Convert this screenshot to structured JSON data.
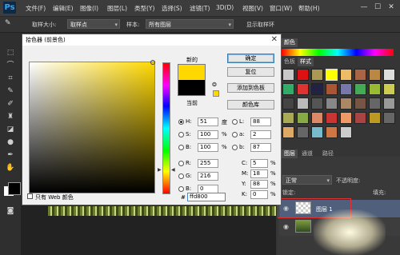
{
  "app": {
    "logo": "Ps"
  },
  "menu": [
    "文件(F)",
    "编辑(E)",
    "图像(I)",
    "图层(L)",
    "类型(Y)",
    "选择(S)",
    "滤镜(T)",
    "3D(D)",
    "视图(V)",
    "窗口(W)",
    "帮助(H)"
  ],
  "window_controls": {
    "minimize": "—",
    "maximize": "☐",
    "close": "✕"
  },
  "options_bar": {
    "sample_size_label": "取样大小:",
    "sample_size_value": "取样点",
    "sample_label": "样本:",
    "sample_value": "所有图层",
    "show_ring_label": "显示取样环"
  },
  "dialog": {
    "title": "拾色器 (前景色)",
    "close": "✕",
    "new_label": "新的",
    "current_label": "当前",
    "buttons": {
      "ok": "确定",
      "reset": "复位",
      "add_swatch": "添加到色板",
      "color_libraries": "颜色库"
    },
    "hsb": [
      {
        "label": "H:",
        "value": "51",
        "unit": "度",
        "checked": true
      },
      {
        "label": "S:",
        "value": "100",
        "unit": "%",
        "checked": false
      },
      {
        "label": "B:",
        "value": "100",
        "unit": "%",
        "checked": false
      }
    ],
    "rgb": [
      {
        "label": "R:",
        "value": "255",
        "checked": false
      },
      {
        "label": "G:",
        "value": "216",
        "checked": false
      },
      {
        "label": "B:",
        "value": "0",
        "checked": false
      }
    ],
    "lab": [
      {
        "label": "L:",
        "value": "88",
        "checked": false
      },
      {
        "label": "a:",
        "value": "2",
        "checked": false
      },
      {
        "label": "b:",
        "value": "87",
        "checked": false
      }
    ],
    "cmyk": [
      {
        "label": "C:",
        "value": "5",
        "unit": "%"
      },
      {
        "label": "M:",
        "value": "18",
        "unit": "%"
      },
      {
        "label": "Y:",
        "value": "88",
        "unit": "%"
      },
      {
        "label": "K:",
        "value": "0",
        "unit": "%"
      }
    ],
    "hex_label": "#",
    "hex_value": "ffd800",
    "only_web_label": "只有 Web 颜色",
    "new_color": "#ffd800",
    "current_color": "#000000"
  },
  "panels": {
    "swatches_tab": "颜色",
    "styles_tab": "色板",
    "styles_tab2": "样式",
    "layers_tab": "图层",
    "channels_tab": "通道",
    "paths_tab": "路径",
    "blend_mode": "正常",
    "opacity_label": "不透明度:",
    "lock_label": "锁定:",
    "fill_label": "填充:",
    "layer1_name": "图层 1"
  }
}
